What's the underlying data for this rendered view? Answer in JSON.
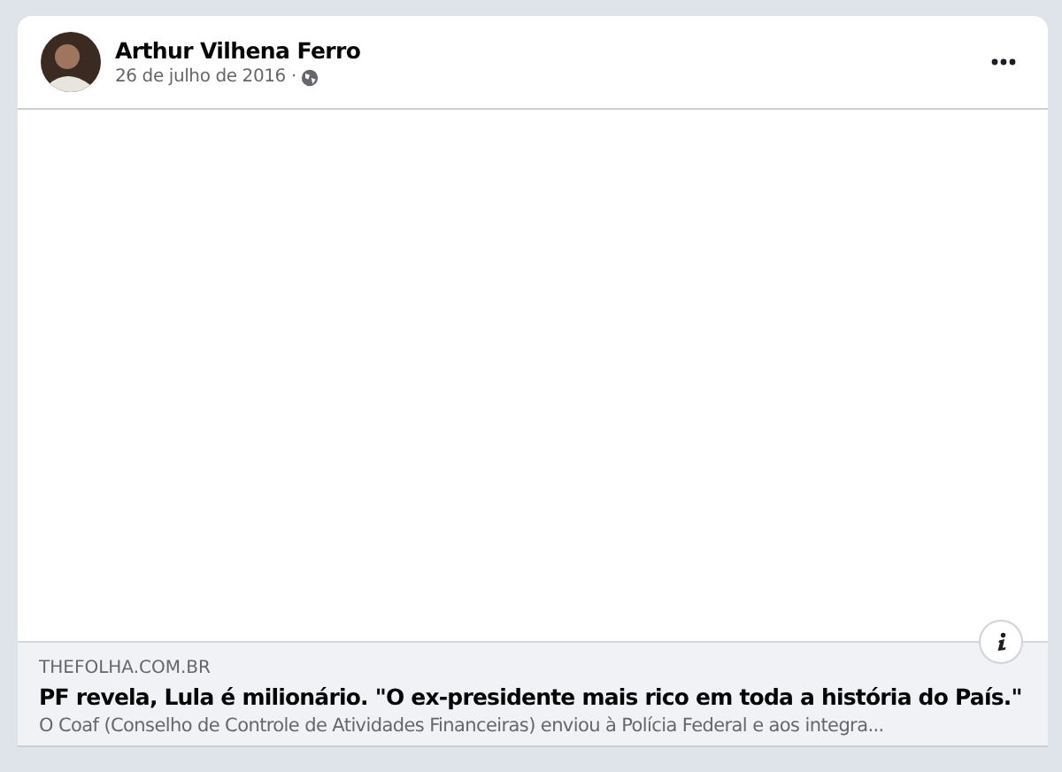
{
  "post": {
    "author": "Arthur Vilhena Ferro",
    "date": "26 de julho de 2016",
    "separator": "·"
  },
  "link_preview": {
    "domain": "THEFOLHA.COM.BR",
    "title": "PF revela, Lula é milionário. \"O ex-presidente mais rico em toda a história do País.\"",
    "description": "O Coaf (Conselho de Controle de Atividades Financeiras) enviou à Polícia Federal e aos integra..."
  }
}
